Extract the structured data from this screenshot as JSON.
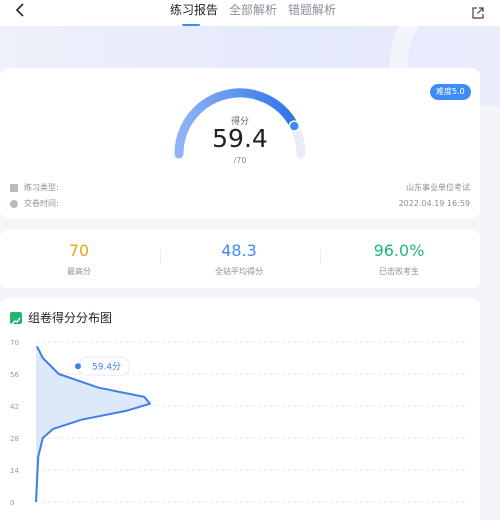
{
  "header": {
    "back_icon": "chevron-left-icon",
    "tabs": [
      {
        "label": "练习报告",
        "active": true
      },
      {
        "label": "全部解析",
        "active": false
      },
      {
        "label": "错题解析",
        "active": false
      }
    ],
    "share_icon": "share-icon",
    "accent": "#3f8cf7"
  },
  "score": {
    "difficulty": "难度5.0",
    "label": "得分",
    "value": "59.4",
    "max": "/70",
    "fraction": 0.849
  },
  "info": {
    "type_label": "练习类型:",
    "type_value": "山东事业单位考试",
    "time_label": "交卷时间:",
    "time_value": "2022.04.19 16:59"
  },
  "stats": [
    {
      "value": "70",
      "label": "最高分",
      "color": "#f0a020"
    },
    {
      "value": "48.3",
      "label": "全站平均得分",
      "color": "#3f8cf7"
    },
    {
      "value": "96.0%",
      "label": "已击败考生",
      "color": "#22b573"
    }
  ],
  "distribution": {
    "title": "组卷得分分布图",
    "icon": "trend-chart-icon"
  },
  "chart_data": {
    "type": "area",
    "title": "组卷得分分布图",
    "y_ticks": [
      "70",
      "56",
      "42",
      "28",
      "14",
      "0"
    ],
    "ylim": [
      0,
      70
    ],
    "marker": {
      "y": 59.4,
      "label": "59.4分"
    },
    "curve": [
      {
        "y": 68,
        "x": 0.01
      },
      {
        "y": 63,
        "x": 0.06
      },
      {
        "y": 56,
        "x": 0.2
      },
      {
        "y": 50,
        "x": 0.55
      },
      {
        "y": 46,
        "x": 0.95
      },
      {
        "y": 43,
        "x": 1.0
      },
      {
        "y": 40,
        "x": 0.8
      },
      {
        "y": 36,
        "x": 0.4
      },
      {
        "y": 32,
        "x": 0.15
      },
      {
        "y": 28,
        "x": 0.06
      },
      {
        "y": 20,
        "x": 0.02
      },
      {
        "y": 10,
        "x": 0.01
      },
      {
        "y": 0,
        "x": 0.0
      }
    ],
    "color": "#3f7fe6",
    "grid": true
  }
}
